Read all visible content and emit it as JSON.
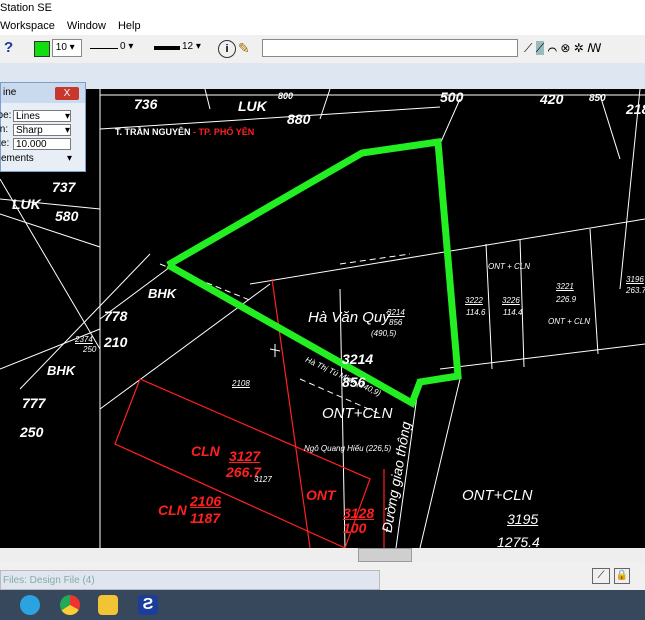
{
  "window": {
    "title": "Station SE"
  },
  "menu": [
    "Workspace",
    "Window",
    "Help"
  ],
  "toolbar": {
    "help": "?",
    "level": "10",
    "line_style": "0",
    "line_weight": "12",
    "info": "i",
    "command": ""
  },
  "dialog": {
    "title": "ine",
    "close": "X",
    "type_label": "Type:",
    "type_value": "Lines",
    "join_label": "Join:",
    "join_value": "Sharp",
    "size_label": "Size:",
    "size_value": "10.000",
    "elements_label": "ements"
  },
  "map": {
    "header": "T. TRẦN NGUYÊN",
    "header_red": "- TP. PHỐ YÊN",
    "labels": [
      {
        "text": "736",
        "cls": ""
      },
      {
        "text": "LUK",
        "cls": ""
      },
      {
        "text": "880",
        "cls": ""
      },
      {
        "text": "800",
        "cls": ""
      },
      {
        "text": "500",
        "cls": ""
      },
      {
        "text": "420",
        "cls": ""
      },
      {
        "text": "850",
        "cls": ""
      },
      {
        "text": "218",
        "cls": ""
      },
      {
        "text": "737",
        "cls": ""
      },
      {
        "text": "580",
        "cls": ""
      },
      {
        "text": "LUK",
        "cls": ""
      },
      {
        "text": "BHK",
        "cls": ""
      },
      {
        "text": "778",
        "cls": ""
      },
      {
        "text": "210",
        "cls": ""
      },
      {
        "text": "BHK",
        "cls": ""
      },
      {
        "text": "777",
        "cls": ""
      },
      {
        "text": "250",
        "cls": ""
      },
      {
        "text": "Hà Văn Quý",
        "cls": ""
      },
      {
        "text": "3214",
        "cls": ""
      },
      {
        "text": "856",
        "cls": ""
      },
      {
        "text": "ONT+CLN",
        "cls": ""
      },
      {
        "text": "CLN",
        "cls": "red"
      },
      {
        "text": "3127",
        "cls": "red"
      },
      {
        "text": "266.7",
        "cls": "red"
      },
      {
        "text": "CLN",
        "cls": "red"
      },
      {
        "text": "2106",
        "cls": "red"
      },
      {
        "text": "1187",
        "cls": "red"
      },
      {
        "text": "ONT",
        "cls": "red"
      },
      {
        "text": "3128",
        "cls": "red"
      },
      {
        "text": "100",
        "cls": "red"
      },
      {
        "text": "ONT+CLN",
        "cls": ""
      },
      {
        "text": "3195",
        "cls": ""
      },
      {
        "text": "1275.4",
        "cls": ""
      },
      {
        "text": "Đường giao thông",
        "cls": ""
      },
      {
        "text": "Ngô Quang Hiếu (226,5)",
        "cls": "small"
      },
      {
        "text": "Hà Thị Tú Minh (140,9)",
        "cls": "small"
      },
      {
        "text": "3222",
        "cls": "small"
      },
      {
        "text": "114.6",
        "cls": "small"
      },
      {
        "text": "3226",
        "cls": "small"
      },
      {
        "text": "114.4",
        "cls": "small"
      },
      {
        "text": "3221",
        "cls": "small"
      },
      {
        "text": "226.9",
        "cls": "small"
      },
      {
        "text": "ONT + CLN",
        "cls": "small"
      },
      {
        "text": "ONT + CLN",
        "cls": "small"
      },
      {
        "text": "2108",
        "cls": "small"
      },
      {
        "text": "2374",
        "cls": "small"
      },
      {
        "text": "250",
        "cls": "small"
      },
      {
        "text": "3196",
        "cls": "small"
      },
      {
        "text": "263.7",
        "cls": "small"
      },
      {
        "text": "3127",
        "cls": "small"
      },
      {
        "text": "(490,5)",
        "cls": "small"
      },
      {
        "text": "3214",
        "cls": "small"
      },
      {
        "text": "856",
        "cls": "small"
      }
    ]
  },
  "taskbar": {
    "items": [
      "telegram-icon",
      "chrome-icon",
      "file-explorer-icon",
      "app-icon"
    ],
    "hidden_window_title": "Files: Design File (4)"
  },
  "colors": {
    "highlight": "#22ee22",
    "red_parcel": "#ff2020",
    "background": "#000000"
  }
}
